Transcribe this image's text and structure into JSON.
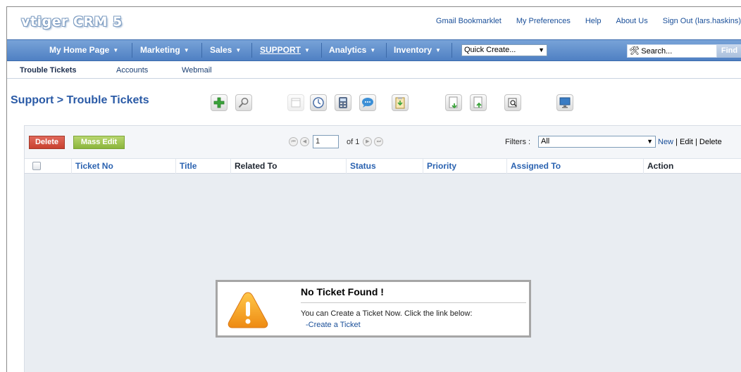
{
  "app": {
    "logo": "vtiger CRM 5"
  },
  "top_links": [
    "Gmail Bookmarklet",
    "My Preferences",
    "Help",
    "About Us",
    "Sign Out (lars.haskins)"
  ],
  "main_nav": {
    "items": [
      "My Home Page",
      "Marketing",
      "Sales",
      "SUPPORT",
      "Analytics",
      "Inventory"
    ],
    "active": "SUPPORT",
    "quick_create": "Quick Create...",
    "search_placeholder": "Search...",
    "find_label": "Find"
  },
  "sub_nav": {
    "items": [
      "Trouble Tickets",
      "Accounts",
      "Webmail"
    ],
    "current": "Trouble Tickets"
  },
  "breadcrumb": "Support > Trouble Tickets",
  "toolbar": {
    "icons": [
      "add-icon",
      "search-icon",
      "calendar-icon",
      "clock-icon",
      "calculator-icon",
      "chat-icon",
      "clipboard-icon",
      "import-icon",
      "export-icon",
      "find-duplicates-icon",
      "monitor-icon"
    ]
  },
  "list": {
    "delete_label": "Delete",
    "mass_edit_label": "Mass Edit",
    "page_value": "1",
    "page_of": "of 1",
    "filters_label": "Filters :",
    "filter_value": "All",
    "filter_new": "New",
    "filter_rest": " | Edit | Delete",
    "columns": [
      "Ticket No",
      "Title",
      "Related To",
      "Status",
      "Priority",
      "Assigned To",
      "Action"
    ]
  },
  "empty_state": {
    "title": "No Ticket Found !",
    "message": "You can Create a Ticket Now. Click the link below:",
    "link": "-Create a Ticket"
  },
  "colors": {
    "nav_bg": "#5b8bcb",
    "link": "#1a4f99",
    "delete": "#d2523f",
    "mass_edit": "#9fc452"
  }
}
